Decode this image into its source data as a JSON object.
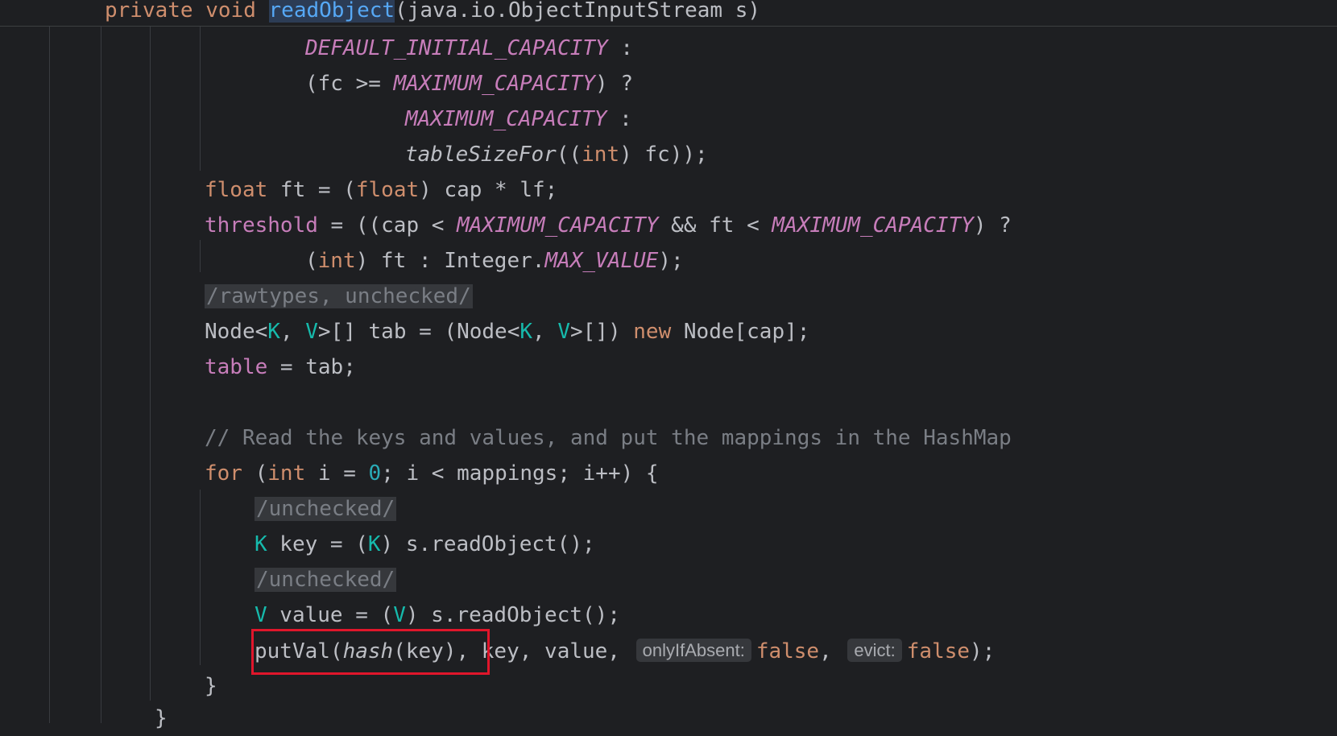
{
  "sticky_header": {
    "kw_private": "private",
    "kw_void": "void",
    "method_name": "readObject",
    "params": "(java.io.ObjectInputStream s)"
  },
  "code": {
    "l1_const": "DEFAULT_INITIAL_CAPACITY",
    "l1_rest": " :",
    "l2_a": "(fc >= ",
    "l2_const": "MAXIMUM_CAPACITY",
    "l2_b": ") ?",
    "l3_const": "MAXIMUM_CAPACITY",
    "l3_rest": " :",
    "l4_fn": "tableSizeFor",
    "l4_a": "((",
    "l4_kw": "int",
    "l4_b": ") fc));",
    "l5_kw1": "float",
    "l5_a": " ft = (",
    "l5_kw2": "float",
    "l5_b": ") cap * lf;",
    "l6_field": "threshold",
    "l6_a": " = ((cap < ",
    "l6_const1": "MAXIMUM_CAPACITY",
    "l6_b": " && ft < ",
    "l6_const2": "MAXIMUM_CAPACITY",
    "l6_c": ") ?",
    "l7_a": "(",
    "l7_kw": "int",
    "l7_b": ") ft : Integer.",
    "l7_const": "MAX_VALUE",
    "l7_c": ");",
    "l8_suppress": "/rawtypes, unchecked/",
    "l9_a": "Node<",
    "l9_k1": "K",
    "l9_b": ", ",
    "l9_v1": "V",
    "l9_c": ">[] tab = (Node<",
    "l9_k2": "K",
    "l9_d": ", ",
    "l9_v2": "V",
    "l9_e": ">[]) ",
    "l9_kw": "new",
    "l9_f": " Node[cap];",
    "l10_field": "table",
    "l10_a": " = tab;",
    "l12_comment": "// Read the keys and values, and put the mappings in the HashMap",
    "l13_kw1": "for",
    "l13_a": " (",
    "l13_kw2": "int",
    "l13_b": " i = ",
    "l13_num": "0",
    "l13_c": "; i < mappings; i++) {",
    "l14_suppress": "/unchecked/",
    "l15_k1": "K",
    "l15_a": " key = (",
    "l15_k2": "K",
    "l15_b": ") s.readObject();",
    "l16_suppress": "/unchecked/",
    "l17_v1": "V",
    "l17_a": " value = (",
    "l17_v2": "V",
    "l17_b": ") s.readObject();",
    "l18_a": "putVal(",
    "l18_fn": "hash",
    "l18_b": "(key), key, value, ",
    "l18_hint1": "onlyIfAbsent:",
    "l18_kw1": "false",
    "l18_c": ", ",
    "l18_hint2": "evict:",
    "l18_kw2": "false",
    "l18_d": ");",
    "l19_brace": "}",
    "l20_brace": "}"
  },
  "colors": {
    "background": "#1e1f22",
    "keyword": "#cf8e6d",
    "constant": "#c77dba",
    "type_param": "#16baac",
    "method_declaration": "#56a8f5",
    "comment": "#7a7e85",
    "highlight_box": "#e0162b"
  }
}
